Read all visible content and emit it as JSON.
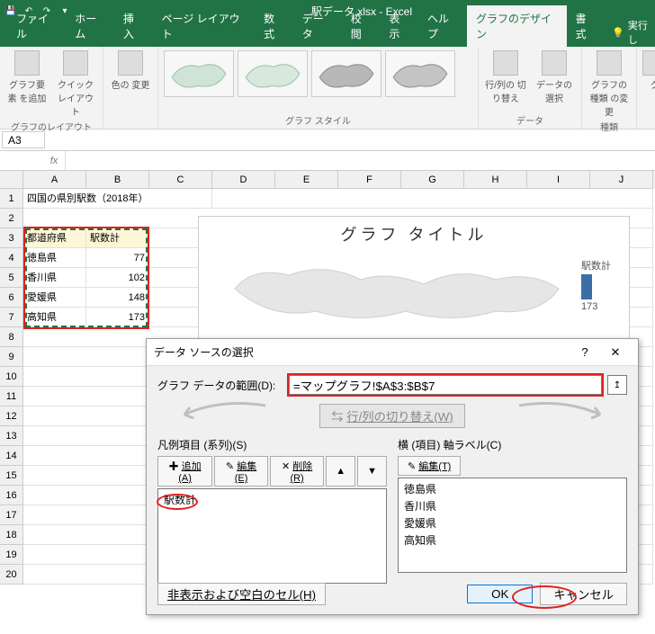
{
  "titlebar": {
    "title": "駅データ.xlsx - Excel"
  },
  "tabs": [
    "ファイル",
    "ホーム",
    "挿入",
    "ページ レイアウト",
    "数式",
    "データ",
    "校閲",
    "表示",
    "ヘルプ",
    "グラフのデザイン",
    "書式"
  ],
  "active_tab_index": 9,
  "tellme": "実行し",
  "ribbon": {
    "g1": {
      "btn1": "グラフ要素\nを追加",
      "btn2": "クイック\nレイアウト",
      "label": "グラフのレイアウト"
    },
    "g2": {
      "btn1": "色の\n変更",
      "label": ""
    },
    "g3": {
      "label": "グラフ スタイル"
    },
    "g4": {
      "btn1": "行/列の\n切り替え",
      "btn2": "データの\n選択",
      "label": "データ"
    },
    "g5": {
      "btn1": "グラフの種類\nの変更",
      "label": "種類"
    },
    "g6": {
      "btn1": "グ"
    }
  },
  "namebox": "A3",
  "fx_label": "fx",
  "cols": [
    "A",
    "B",
    "C",
    "D",
    "E",
    "F",
    "G",
    "H",
    "I",
    "J"
  ],
  "rows": {
    "title_row": "四国の県別駅数（2018年）",
    "headers": [
      "都道府県",
      "駅数計"
    ],
    "data": [
      {
        "pref": "徳島県",
        "count": 77
      },
      {
        "pref": "香川県",
        "count": 102
      },
      {
        "pref": "愛媛県",
        "count": 148
      },
      {
        "pref": "高知県",
        "count": 173
      }
    ]
  },
  "chart": {
    "title": "グラフ タイトル",
    "legend_label": "駅数計",
    "legend_value": "173"
  },
  "dialog": {
    "title": "データ ソースの選択",
    "range_label": "グラフ データの範囲(D):",
    "range_value": "=マップグラフ!$A$3:$B$7",
    "switch_label": "行/列の切り替え(W)",
    "series_label": "凡例項目 (系列)(S)",
    "series_buttons": {
      "add": "追加(A)",
      "edit": "編集(E)",
      "del": "削除(R)"
    },
    "series_items": [
      "駅数計"
    ],
    "axis_label": "横 (項目) 軸ラベル(C)",
    "axis_buttons": {
      "edit": "編集(T)"
    },
    "axis_items": [
      "徳島県",
      "香川県",
      "愛媛県",
      "高知県"
    ],
    "hidden_label": "非表示および空白のセル(H)",
    "ok": "OK",
    "cancel": "キャンセル"
  }
}
